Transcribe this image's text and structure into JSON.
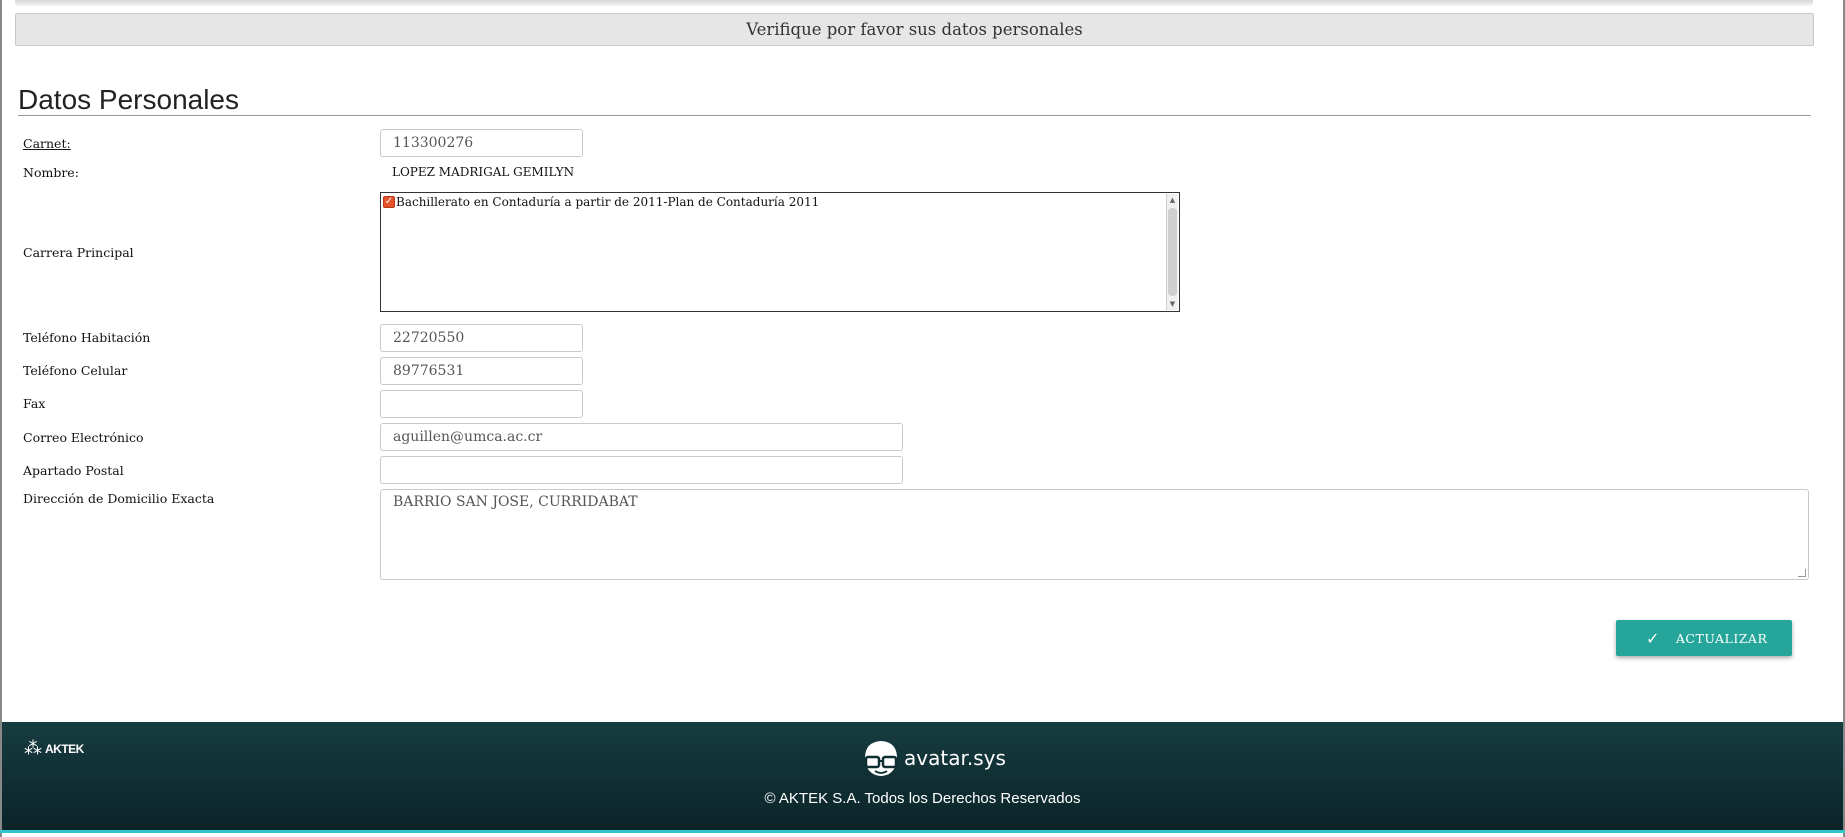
{
  "banner": {
    "text": "Verifique por favor sus datos personales"
  },
  "section": {
    "title": "Datos Personales"
  },
  "fields": {
    "carnet": {
      "label": "Carnet:",
      "value": "113300276"
    },
    "nombre": {
      "label": "Nombre:",
      "value": "LOPEZ MADRIGAL GEMILYN"
    },
    "carrera": {
      "label": "Carrera Principal",
      "option": "Bachillerato en Contaduría a partir de 2011-Plan de Contaduría 2011",
      "checked": true
    },
    "tel_hab": {
      "label": "Teléfono Habitación",
      "value": "22720550"
    },
    "tel_cel": {
      "label": "Teléfono Celular",
      "value": "89776531"
    },
    "fax": {
      "label": "Fax",
      "value": ""
    },
    "correo": {
      "label": "Correo Electrónico",
      "value": "aguillen@umca.ac.cr"
    },
    "apartado": {
      "label": "Apartado Postal",
      "value": ""
    },
    "direccion": {
      "label": "Dirección de Domicilio Exacta",
      "value": "BARRIO SAN JOSE, CURRIDABAT"
    }
  },
  "actions": {
    "update_label": "ACTUALIZAR",
    "update_icon": "check-icon"
  },
  "footer": {
    "left_logo": "AKTEK",
    "brand": "avatar.sys",
    "copyright": "© AKTEK S.A. Todos los Derechos Reservados"
  },
  "colors": {
    "accent": "#26a69a",
    "footer_bg": "#0f2f33",
    "footer_line": "#33c6cf",
    "checkbox": "#e5522a"
  }
}
